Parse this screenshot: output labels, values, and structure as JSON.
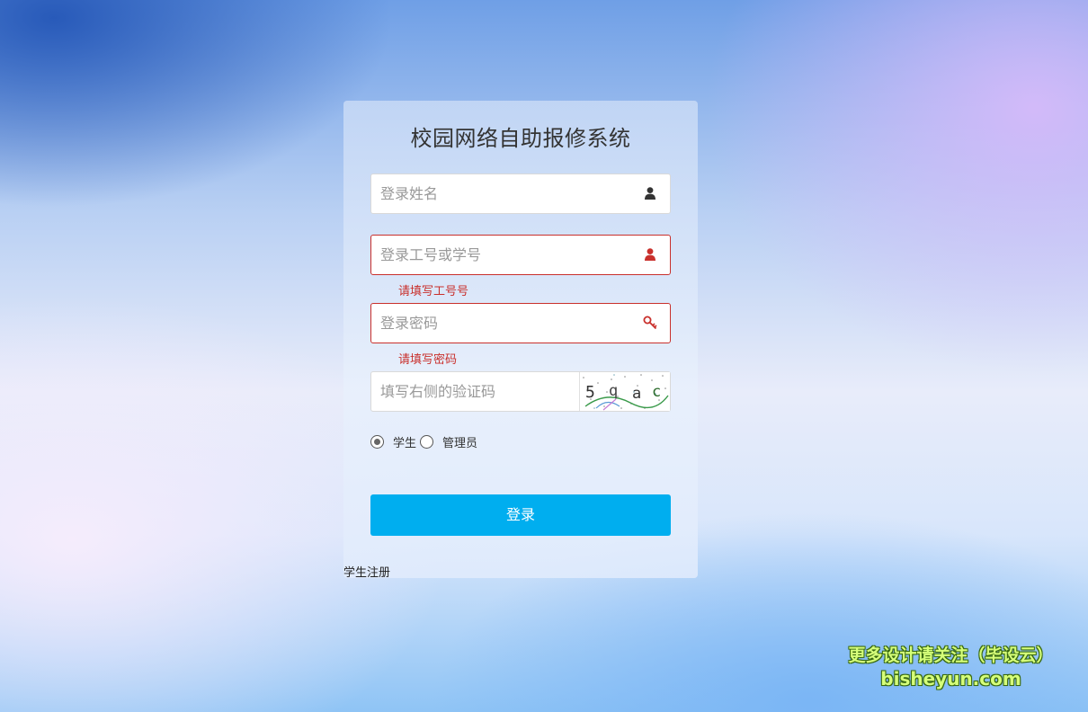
{
  "login": {
    "title": "校园网络自助报修系统",
    "name_placeholder": "登录姓名",
    "id_placeholder": "登录工号或学号",
    "id_error": "请填写工号号",
    "password_placeholder": "登录密码",
    "password_error": "请填写密码",
    "captcha_placeholder": "填写右侧的验证码",
    "captcha_chars": [
      "5",
      "q",
      "a",
      "c"
    ],
    "roles": [
      {
        "label": "学生",
        "checked": true
      },
      {
        "label": "管理员",
        "checked": false
      }
    ],
    "login_button": "登录",
    "register_link": "学生注册"
  },
  "watermark": {
    "line1": "更多设计请关注（毕设云）",
    "line2": "bisheyun.com"
  },
  "colors": {
    "accent": "#00aeef",
    "error": "#c9302c"
  },
  "icons": {
    "name": "user-icon",
    "id": "user-icon",
    "password": "key-icon"
  }
}
